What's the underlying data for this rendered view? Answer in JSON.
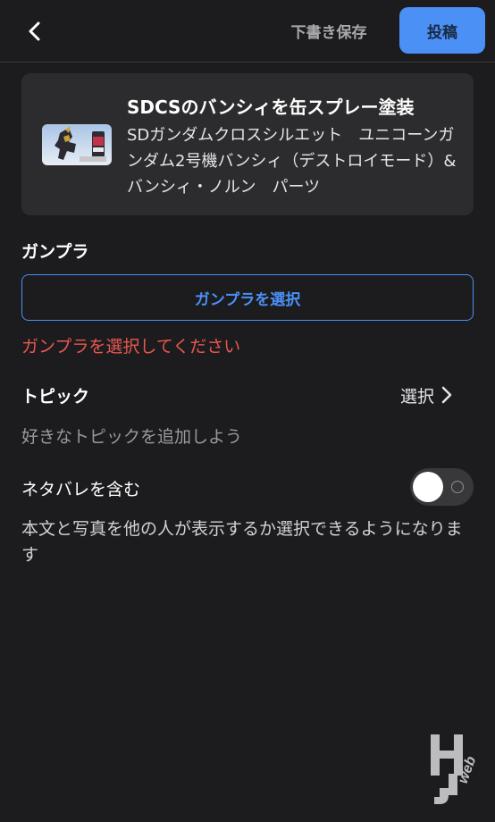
{
  "header": {
    "back_icon": "chevron-left-icon",
    "draft_label": "下書き保存",
    "post_label": "投稿",
    "post_color": "#4a90f5"
  },
  "article": {
    "title": "SDCSのバンシィを缶スプレー塗装",
    "description": "SDガンダムクロスシルエット　ユニコーンガンダム2号機バンシィ（デストロイモード）&バンシィ・ノルン　パーツ"
  },
  "gunpla": {
    "label": "ガンプラ",
    "select_button": "ガンプラを選択",
    "error": "ガンプラを選択してください",
    "error_color": "#e8574f"
  },
  "topic": {
    "label": "トピック",
    "select_label": "選択",
    "hint": "好きなトピックを追加しよう"
  },
  "spoiler": {
    "label": "ネタバレを含む",
    "enabled": false,
    "description": "本文と写真を他の人が表示するか選択できるようになります"
  },
  "watermark": {
    "text": "HJweb"
  }
}
